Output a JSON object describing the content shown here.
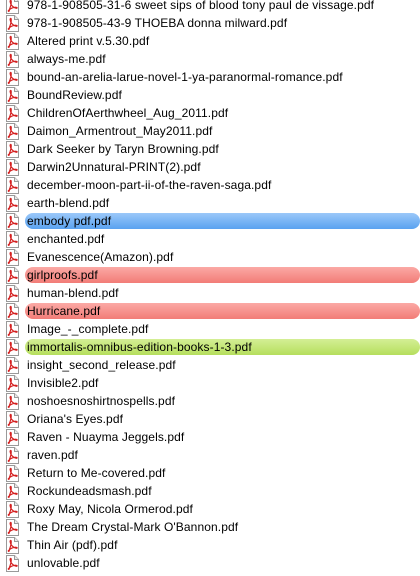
{
  "files": [
    {
      "name": "978-1-908505-31-6 sweet sips of blood tony paul de vissage.pdf",
      "label": null
    },
    {
      "name": "978-1-908505-43-9 THOEBA donna milward.pdf",
      "label": null
    },
    {
      "name": "Altered print v.5.30.pdf",
      "label": null
    },
    {
      "name": "always-me.pdf",
      "label": null
    },
    {
      "name": "bound-an-arelia-larue-novel-1-ya-paranormal-romance.pdf",
      "label": null
    },
    {
      "name": "BoundReview.pdf",
      "label": null
    },
    {
      "name": "ChildrenOfAerthwheel_Aug_2011.pdf",
      "label": null
    },
    {
      "name": "Daimon_Armentrout_May2011.pdf",
      "label": null
    },
    {
      "name": "Dark Seeker by Taryn Browning.pdf",
      "label": null
    },
    {
      "name": "Darwin2Unnatural-PRINT(2).pdf",
      "label": null
    },
    {
      "name": "december-moon-part-ii-of-the-raven-saga.pdf",
      "label": null
    },
    {
      "name": "earth-blend.pdf",
      "label": null
    },
    {
      "name": "embody pdf.pdf",
      "label": "blue"
    },
    {
      "name": "enchanted.pdf",
      "label": null
    },
    {
      "name": "Evanescence(Amazon).pdf",
      "label": null
    },
    {
      "name": "girlproofs.pdf",
      "label": "red"
    },
    {
      "name": "human-blend.pdf",
      "label": null
    },
    {
      "name": "Hurricane.pdf",
      "label": "red"
    },
    {
      "name": "Image_-_complete.pdf",
      "label": null
    },
    {
      "name": "immortalis-omnibus-edition-books-1-3.pdf",
      "label": "green"
    },
    {
      "name": "insight_second_release.pdf",
      "label": null
    },
    {
      "name": "Invisible2.pdf",
      "label": null
    },
    {
      "name": "noshoesnoshirtnospells.pdf",
      "label": null
    },
    {
      "name": "Oriana's Eyes.pdf",
      "label": null
    },
    {
      "name": "Raven - Nuayma Jeggels.pdf",
      "label": null
    },
    {
      "name": "raven.pdf",
      "label": null
    },
    {
      "name": "Return to Me-covered.pdf",
      "label": null
    },
    {
      "name": "Rockundeadsmash.pdf",
      "label": null
    },
    {
      "name": "Roxy May, Nicola Ormerod.pdf",
      "label": null
    },
    {
      "name": "The Dream Crystal-Mark O'Bannon.pdf",
      "label": null
    },
    {
      "name": "Thin Air (pdf).pdf",
      "label": null
    },
    {
      "name": "unlovable.pdf",
      "label": null
    }
  ],
  "icon": "pdf-document-icon",
  "colors": {
    "label_blue": "#5aa2f0",
    "label_red": "#f27c77",
    "label_green": "#b5de5d",
    "pdf_red": "#d42020"
  }
}
